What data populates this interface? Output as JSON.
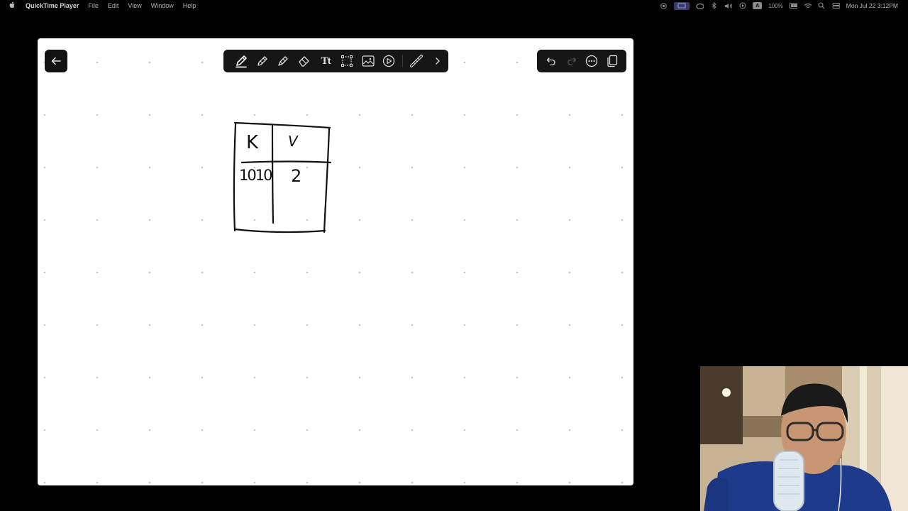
{
  "menubar": {
    "app_name": "QuickTime Player",
    "menus": [
      "File",
      "Edit",
      "View",
      "Window",
      "Help"
    ],
    "battery": "100%",
    "clock": "Mon Jul 22  3:12PM"
  },
  "board": {
    "table_header_key": "K",
    "table_header_value": "V",
    "row_key": "1010",
    "row_value": "2"
  },
  "toolbar": {
    "tools": [
      "pen-icon",
      "pencil-icon",
      "highlighter-icon",
      "eraser-icon",
      "text-tool-icon",
      "lasso-select-icon",
      "image-icon",
      "shapes-icon",
      "ruler-icon",
      "chevron-right-icon"
    ],
    "text_tool_glyph": "Tt"
  },
  "colors": {
    "background": "#000000",
    "board": "#ffffff",
    "toolbar": "#161616",
    "ink": "#111111"
  }
}
